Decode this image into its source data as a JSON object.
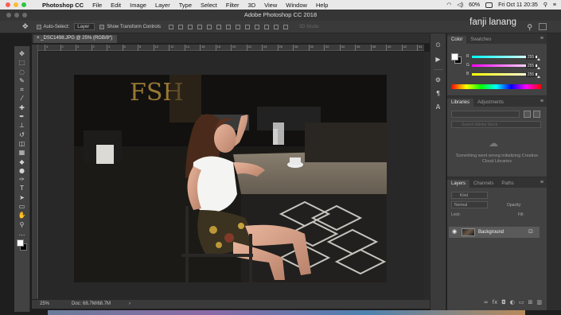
{
  "menubar": {
    "app_name": "Photoshop CC",
    "items": [
      "File",
      "Edit",
      "Image",
      "Layer",
      "Type",
      "Select",
      "Filter",
      "3D",
      "View",
      "Window",
      "Help"
    ],
    "battery": "60%",
    "datetime": "Fri Oct 11  20:35",
    "traffic_colors": [
      "#fc5f57",
      "#fdbc2e",
      "#28c840"
    ]
  },
  "window": {
    "title": "Adobe Photoshop CC 2018",
    "user_name": "fanji lanang"
  },
  "options_bar": {
    "auto_select_label": "Auto-Select:",
    "auto_select_value": "Layer",
    "transform_controls_label": "Show Transform Controls",
    "mode_3d_label": "3D Mode:"
  },
  "document": {
    "tab_title": "_DSC1498.JPG @ 25% (RGB/8*)",
    "zoom": "25%",
    "doc_size": "Doc: 68.7M/68.7M",
    "ruler_labels": [
      "4",
      "2",
      "0",
      "2",
      "4",
      "6",
      "8",
      "10",
      "12",
      "14",
      "16",
      "18",
      "20",
      "22",
      "24",
      "26",
      "28",
      "30",
      "32",
      "34",
      "36",
      "38",
      "40",
      "42",
      "44"
    ]
  },
  "tools": [
    {
      "name": "move-tool-icon",
      "glyph": "✥"
    },
    {
      "name": "marquee-tool-icon",
      "glyph": "⬚"
    },
    {
      "name": "lasso-tool-icon",
      "glyph": "◌"
    },
    {
      "name": "quick-select-tool-icon",
      "glyph": "✎"
    },
    {
      "name": "crop-tool-icon",
      "glyph": "⌗"
    },
    {
      "name": "eyedropper-tool-icon",
      "glyph": "⁄"
    },
    {
      "name": "healing-brush-tool-icon",
      "glyph": "✚"
    },
    {
      "name": "brush-tool-icon",
      "glyph": "✒"
    },
    {
      "name": "clone-stamp-tool-icon",
      "glyph": "⊥"
    },
    {
      "name": "history-brush-tool-icon",
      "glyph": "↺"
    },
    {
      "name": "eraser-tool-icon",
      "glyph": "◫"
    },
    {
      "name": "gradient-tool-icon",
      "glyph": "▦"
    },
    {
      "name": "blur-tool-icon",
      "glyph": "◆"
    },
    {
      "name": "dodge-tool-icon",
      "glyph": "●"
    },
    {
      "name": "pen-tool-icon",
      "glyph": "✑"
    },
    {
      "name": "type-tool-icon",
      "glyph": "T"
    },
    {
      "name": "path-select-tool-icon",
      "glyph": "➤"
    },
    {
      "name": "shape-tool-icon",
      "glyph": "▭"
    },
    {
      "name": "hand-tool-icon",
      "glyph": "✋"
    },
    {
      "name": "zoom-tool-icon",
      "glyph": "⚲"
    },
    {
      "name": "more-tools-icon",
      "glyph": "…"
    }
  ],
  "color_panel": {
    "tabs": [
      "Color",
      "Swatches"
    ],
    "channels": [
      {
        "label": "R",
        "value": "255",
        "gradient": "linear-gradient(90deg,#00ffff,#ffffff)"
      },
      {
        "label": "G",
        "value": "255",
        "gradient": "linear-gradient(90deg,#ff00ff,#ffffff)"
      },
      {
        "label": "B",
        "value": "255",
        "gradient": "linear-gradient(90deg,#ffff00,#ffffff)"
      }
    ]
  },
  "libraries_panel": {
    "tabs": [
      "Libraries",
      "Adjustments"
    ],
    "search_placeholder": "Search Adobe Stock",
    "message": "Something went wrong initializing Creative Cloud Libraries"
  },
  "layers_panel": {
    "tabs": [
      "Layers",
      "Channels",
      "Paths"
    ],
    "filter_label": "Kind",
    "blend_mode": "Normal",
    "opacity_label": "Opacity:",
    "lock_label": "Lock:",
    "fill_label": "Fill:",
    "layers": [
      {
        "name": "Background"
      }
    ]
  }
}
